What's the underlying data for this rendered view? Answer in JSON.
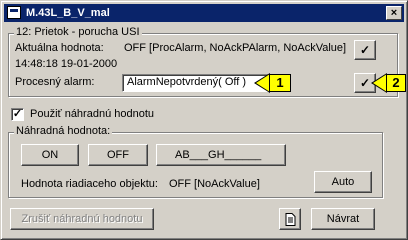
{
  "window": {
    "title": "M.43L_B_V_mal",
    "close_glyph": "×"
  },
  "group_main": {
    "legend": "12: Prietok - porucha USI",
    "current_value_label": "Aktuálna hodnota:",
    "current_value": "OFF [ProcAlarm, NoAckPAlarm, NoAckValue]",
    "timestamp": "14:48:18 19-01-2000",
    "process_alarm_label": "Procesný alarm:",
    "process_alarm_value": "AlarmNepotvrdený( Off )",
    "callout_1": "1",
    "callout_2": "2",
    "confirm_glyph": "✓"
  },
  "substitute_checkbox": {
    "label": "Použiť náhradnú hodnotu",
    "checked_glyph": "✓"
  },
  "group_substitute": {
    "legend": "Náhradná hodnota:",
    "on_label": "ON",
    "off_label": "OFF",
    "text_value": "AB___GH______",
    "object_value_label": "Hodnota riadiaceho objektu:",
    "object_value": "OFF [NoAckValue]",
    "auto_label": "Auto"
  },
  "footer": {
    "cancel_substitute_label": "Zrušiť náhradnú hodnotu",
    "notes_icon": "document-icon",
    "back_label": "Návrat"
  },
  "colors": {
    "titlebar": "#0a246a",
    "callout": "#ffff00"
  }
}
